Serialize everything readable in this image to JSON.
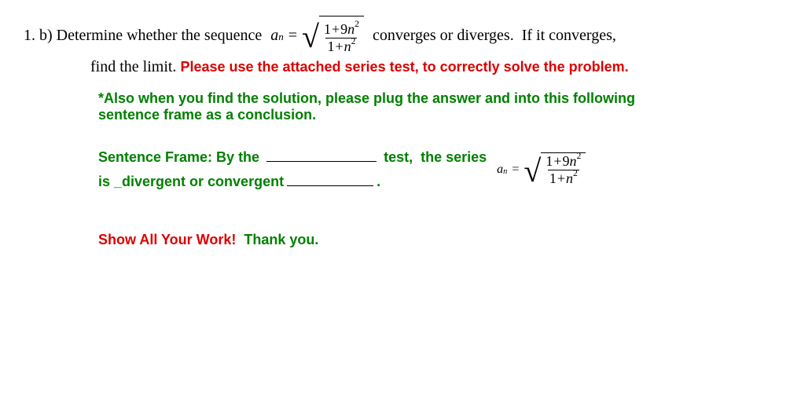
{
  "question": {
    "number": "1.  b)",
    "prompt_before": " Determine whether the sequence ",
    "prompt_after": " converges or diverges.  If it converges,",
    "line2_black": "find the limit. ",
    "line2_red": "Please use the attached series test, to correctly solve the problem."
  },
  "note": {
    "line1": "*Also when you find the solution, please plug the answer and  into this following",
    "line2": "sentence frame as a conclusion."
  },
  "frame": {
    "label": "Sentence Frame: By the ",
    "middle": " test,  the series ",
    "line2": "is _divergent or convergent",
    "end": "."
  },
  "footer": {
    "red": "Show All Your Work!  ",
    "green": "Thank you."
  },
  "formula": {
    "var": "a",
    "sub": "n",
    "eq": "=",
    "num_pre": "1",
    "num_plus": "+",
    "num_coef": "9",
    "num_var": "n",
    "num_exp": "2",
    "den_pre": "1",
    "den_plus": "+",
    "den_var": "n",
    "den_exp": "2"
  }
}
